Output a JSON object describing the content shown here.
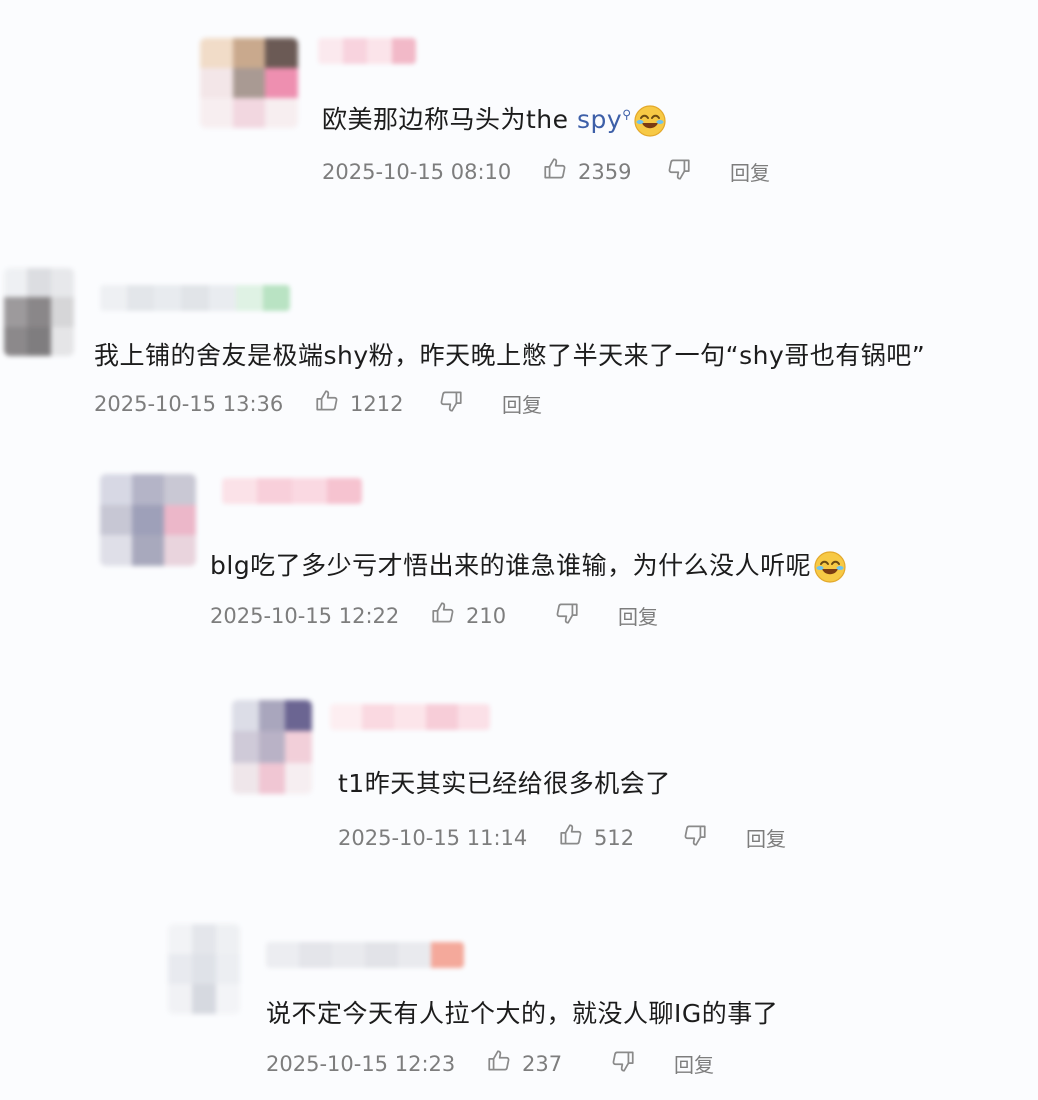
{
  "comments": [
    {
      "text": "欧美那边称马头为the ",
      "link": "spy",
      "has_emoji": true,
      "time": "2025-10-15 08:10",
      "likes": "2359",
      "reply": "回复",
      "avatar_colors": [
        "#f1dcc8",
        "#c9a98d",
        "#6b5a55",
        "#f3e6e8",
        "#a99a93",
        "#ee8fb0",
        "#f7eef0",
        "#f2d7e0",
        "#f7eef0"
      ],
      "name_colors": [
        "#fbe9ee",
        "#f8d3de",
        "#fbe4ea",
        "#f2b9c8"
      ]
    },
    {
      "text": "我上铺的舍友是极端shy粉，昨天晚上憋了半天来了一句“shy哥也有锅吧”",
      "link": "",
      "has_emoji": false,
      "time": "2025-10-15 13:36",
      "likes": "1212",
      "reply": "回复",
      "avatar_colors": [
        "#eef0f3",
        "#dcdde1",
        "#e7e8eb",
        "#9d9a9c",
        "#8a8789",
        "#d6d6d8",
        "#8c898b",
        "#7f7d7f",
        "#e5e5e7"
      ],
      "name_colors": [
        "#eef0f3",
        "#e3e6ea",
        "#e8ebef",
        "#e1e4e8",
        "#e9ecf0",
        "#dff2e4",
        "#b9e3c3"
      ]
    },
    {
      "text": "blg吃了多少亏才悟出来的谁急谁输，为什么没人听呢",
      "link": "",
      "has_emoji": true,
      "time": "2025-10-15 12:22",
      "likes": "210",
      "reply": "回复",
      "avatar_colors": [
        "#d7d8e4",
        "#b4b4c7",
        "#c9c8d4",
        "#c7c7d4",
        "#9ea0b9",
        "#ecb7c9",
        "#dfdfe8",
        "#a8a9bd",
        "#e9d4dd"
      ],
      "name_colors": [
        "#fbe2e8",
        "#f8cfda",
        "#fad9e2",
        "#f6c3d0"
      ]
    },
    {
      "text": "t1昨天其实已经给很多机会了",
      "link": "",
      "has_emoji": false,
      "time": "2025-10-15 11:14",
      "likes": "512",
      "reply": "回复",
      "avatar_colors": [
        "#dcdde7",
        "#a9a6bd",
        "#6b6592",
        "#cfcad8",
        "#b9b2c6",
        "#f2cfd9",
        "#efe6ea",
        "#f0c6d3",
        "#f6eef1"
      ],
      "name_colors": [
        "#fdeef1",
        "#fad9e1",
        "#fce5ea",
        "#f7cdd8",
        "#fbe0e7"
      ]
    },
    {
      "text": "说不定今天有人拉个大的，就没人聊IG的事了",
      "link": "",
      "has_emoji": false,
      "time": "2025-10-15 12:23",
      "likes": "237",
      "reply": "回复",
      "avatar_colors": [
        "#f2f3f6",
        "#e4e6eb",
        "#eef0f3",
        "#e8eaef",
        "#dfe2e8",
        "#eceef2",
        "#f1f2f5",
        "#d6d9e0",
        "#f3f4f7"
      ],
      "name_colors": [
        "#ecedf1",
        "#e4e5ea",
        "#e9eaee",
        "#e2e3e8",
        "#e9eaee",
        "#f4a99b"
      ]
    }
  ]
}
